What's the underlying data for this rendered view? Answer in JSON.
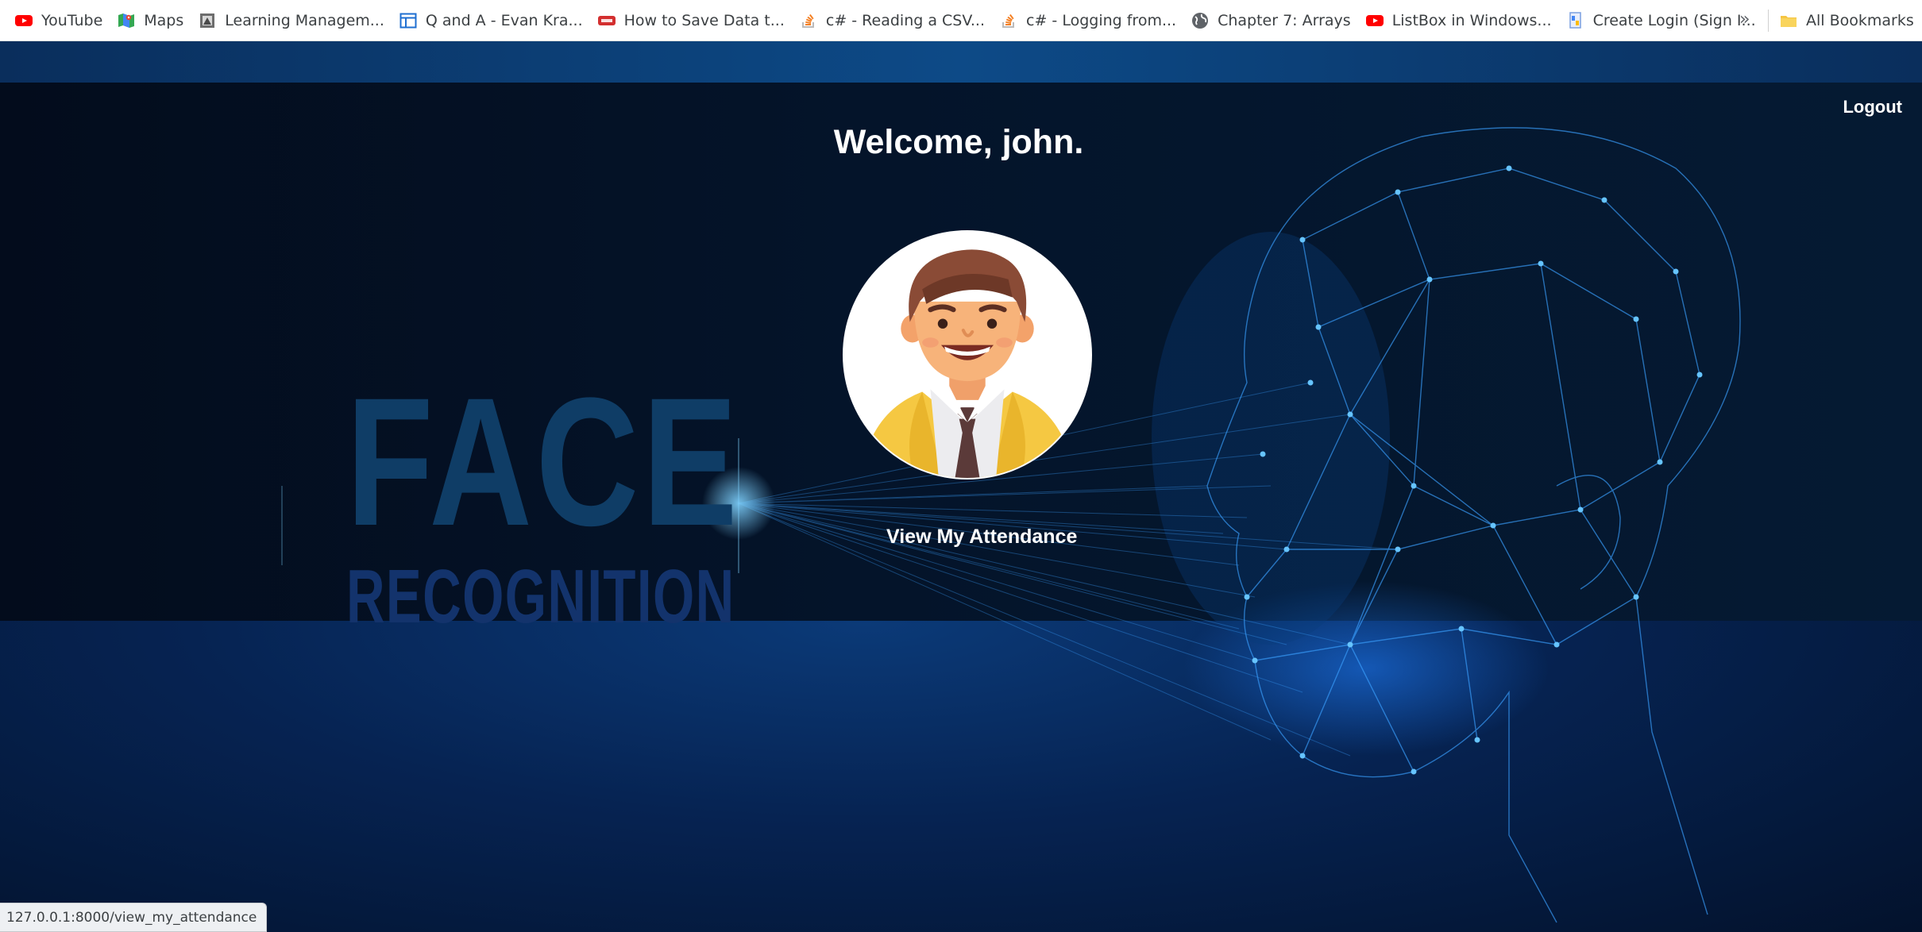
{
  "bookmarks": [
    {
      "label": "YouTube",
      "icon": "youtube-icon"
    },
    {
      "label": "Maps",
      "icon": "maps-icon"
    },
    {
      "label": "Learning Managem...",
      "icon": "lms-icon"
    },
    {
      "label": "Q and A - Evan Kra...",
      "icon": "board-icon"
    },
    {
      "label": "How to Save Data t...",
      "icon": "video-icon"
    },
    {
      "label": "c# - Reading a CSV...",
      "icon": "stackoverflow-icon"
    },
    {
      "label": "c# - Logging from...",
      "icon": "stackoverflow-icon"
    },
    {
      "label": "Chapter 7: Arrays",
      "icon": "globe-icon"
    },
    {
      "label": "ListBox in Windows...",
      "icon": "youtube-icon"
    },
    {
      "label": "Create Login (Sign I...",
      "icon": "page-icon"
    }
  ],
  "bookmarks_overflow": "»",
  "all_bookmarks": "All Bookmarks",
  "page": {
    "welcome": "Welcome, john.",
    "logout": "Logout",
    "view_attendance": "View My Attendance",
    "bg_text_face": "FACE",
    "bg_text_recognition": "RECOGNITION"
  },
  "status_url": "127.0.0.1:8000/view_my_attendance",
  "colors": {
    "youtube_red": "#ff0000",
    "page_dark": "#04142a",
    "mesh_blue": "#3aa0ff",
    "text_white": "#ffffff"
  }
}
